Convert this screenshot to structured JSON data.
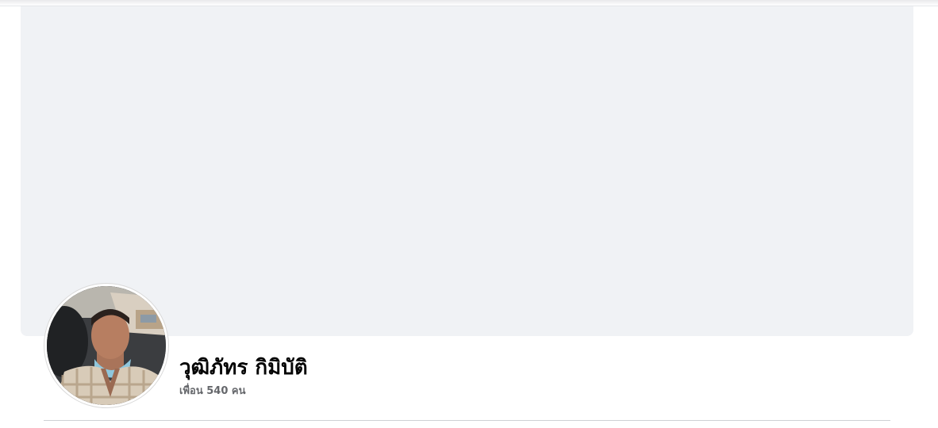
{
  "profile": {
    "name": "วุฒิภัทร กิมิบัติ",
    "friends_text": "เพื่อน 540 คน"
  },
  "colors": {
    "cover_background": "#f0f2f5",
    "name_text": "#050505",
    "secondary_text": "#65676b",
    "divider": "#ced0d4"
  }
}
